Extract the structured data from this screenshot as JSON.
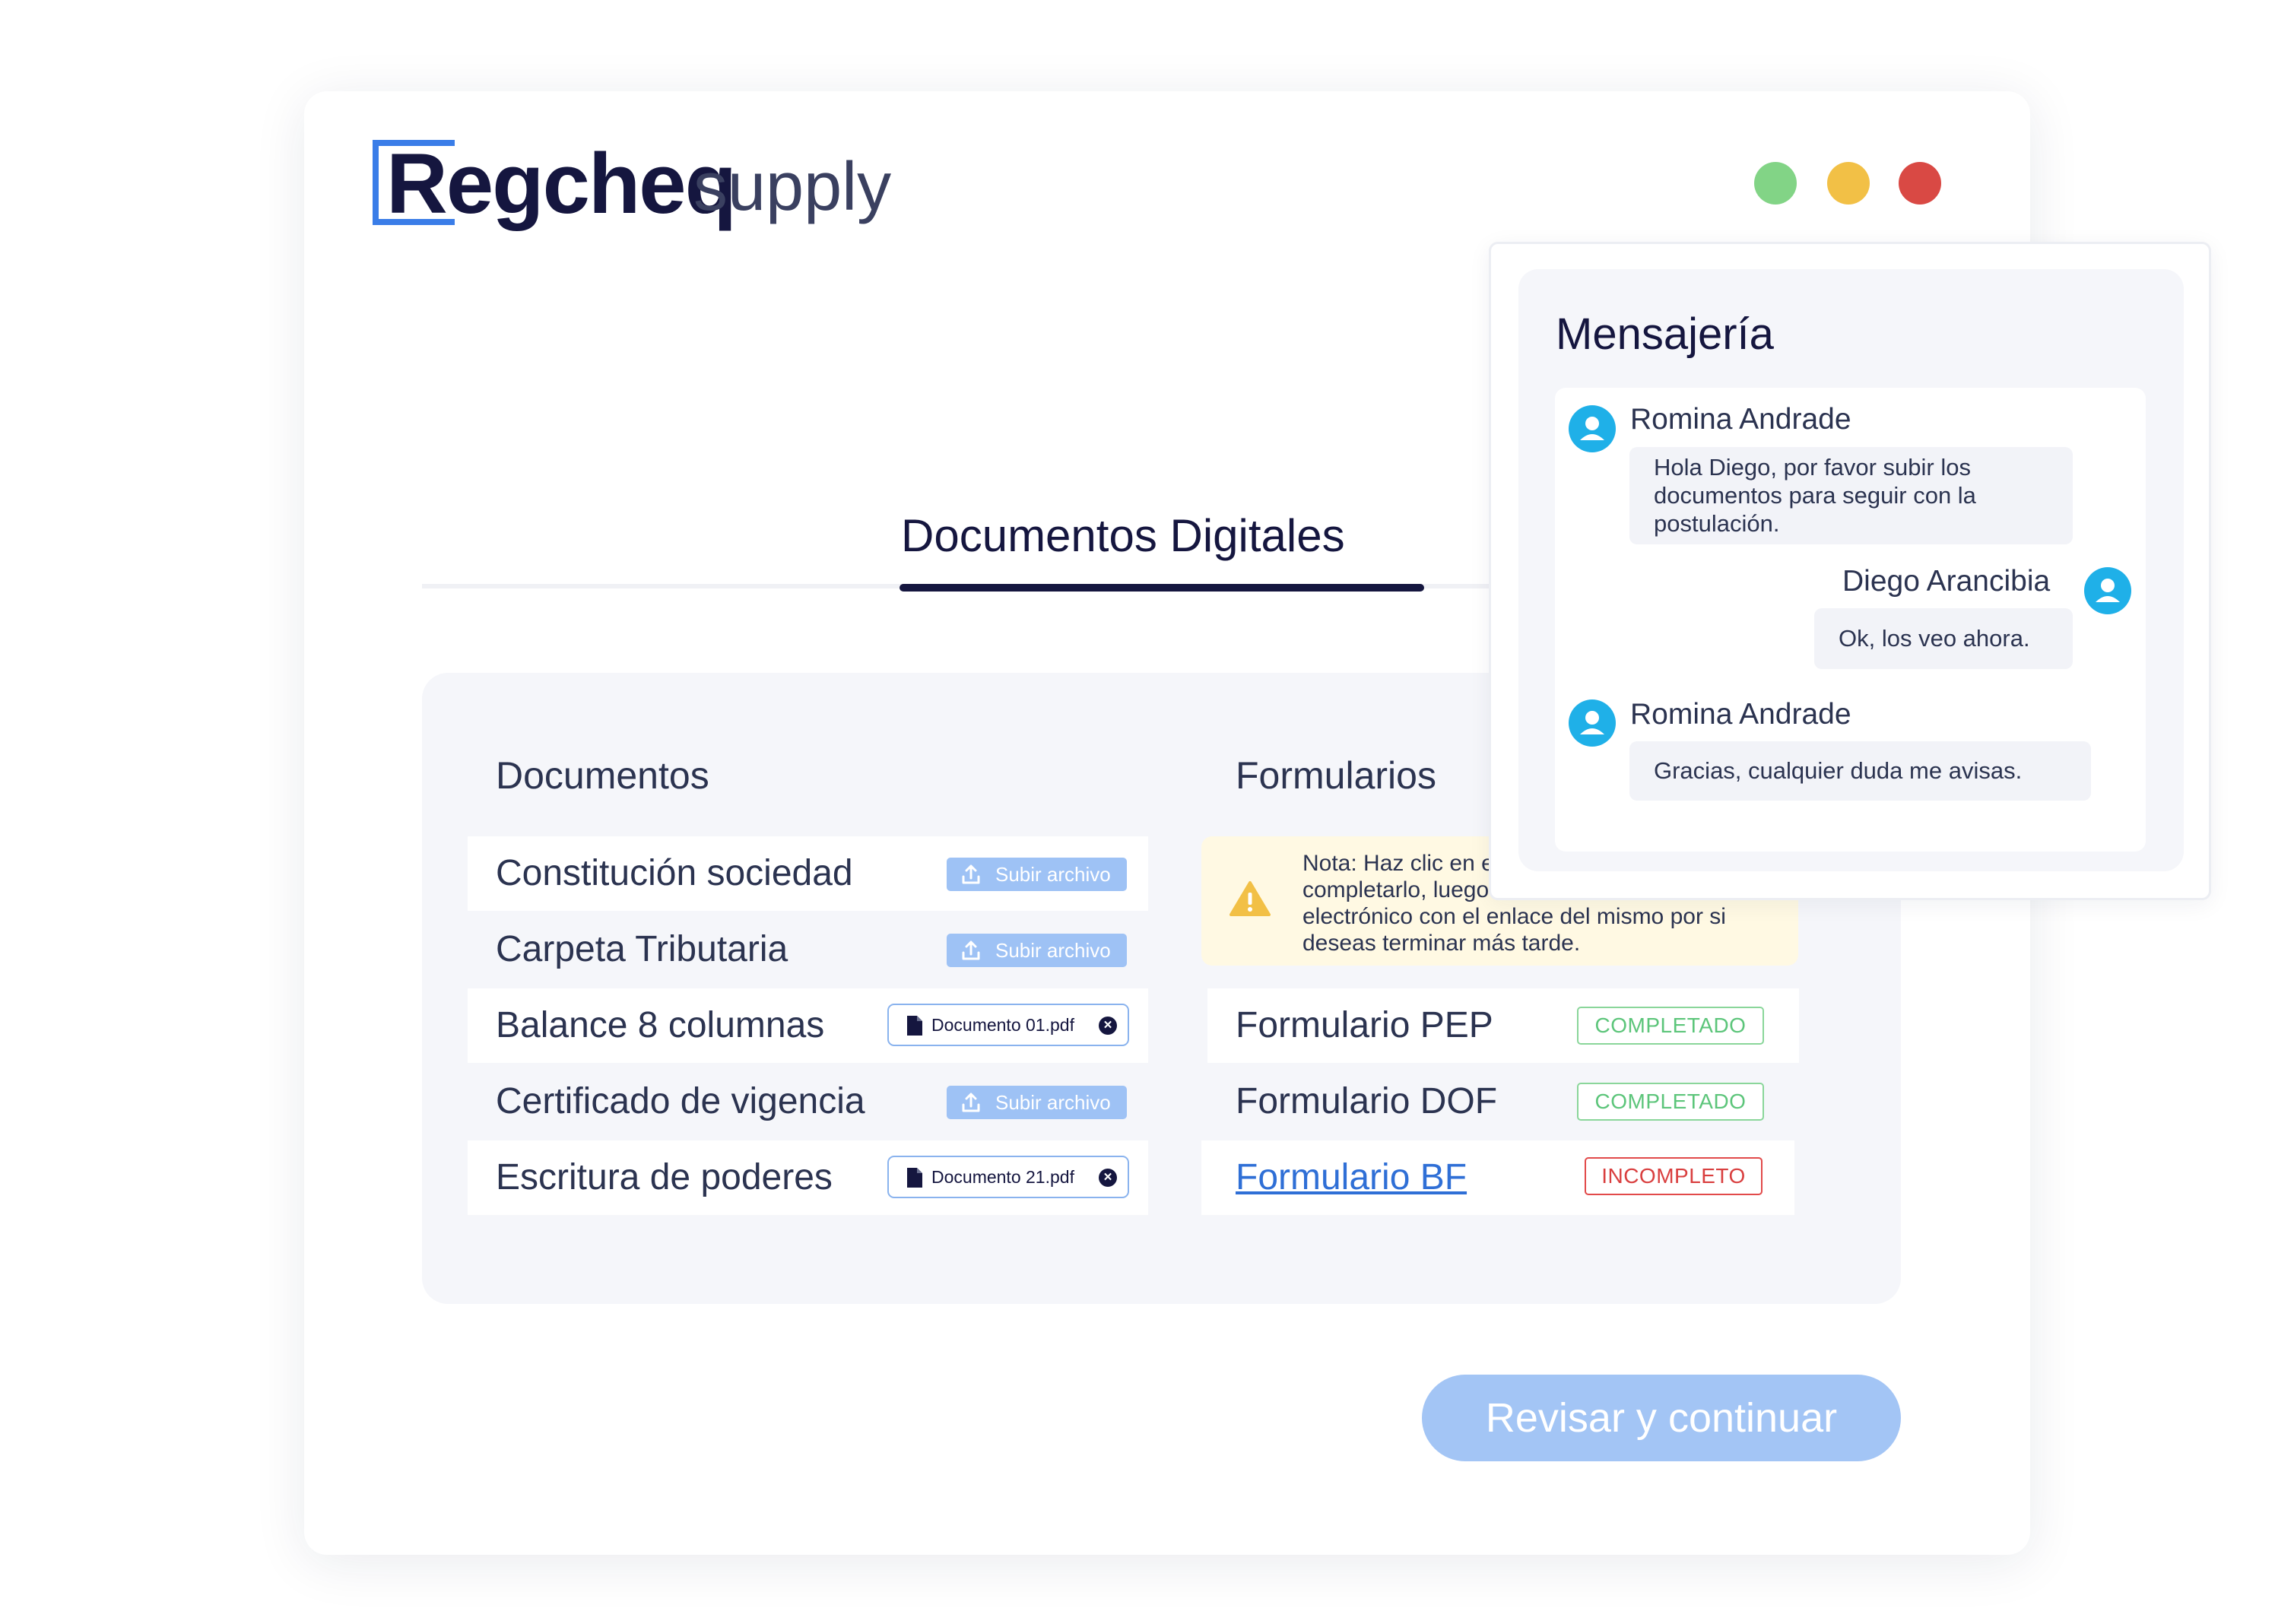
{
  "brand": {
    "name": "Regcheq",
    "product": "supply"
  },
  "window_controls": {
    "colors": {
      "green": "#82d486",
      "yellow": "#f2c046",
      "red": "#d94944"
    }
  },
  "tab": {
    "title": "Documentos Digitales"
  },
  "documents": {
    "heading": "Documentos",
    "rows": [
      {
        "label": "Constitución sociedad",
        "action": "Subir archivo"
      },
      {
        "label": "Carpeta Tributaria",
        "action": "Subir archivo"
      },
      {
        "label": "Balance 8 columnas",
        "file": "Documento 01.pdf"
      },
      {
        "label": "Certificado de vigencia",
        "action": "Subir archivo"
      },
      {
        "label": "Escritura de poderes",
        "file": "Documento 21.pdf"
      }
    ]
  },
  "forms": {
    "heading": "Formularios",
    "note": "Nota: Haz clic en el formulario para completarlo, luego recibirás un correo electrónico con el enlace del mismo por si deseas terminar más tarde.",
    "rows": [
      {
        "label": "Formulario PEP",
        "status": "COMPLETADO"
      },
      {
        "label": "Formulario DOF",
        "status": "COMPLETADO"
      },
      {
        "label": "Formulario BF",
        "status": "INCOMPLETO"
      }
    ]
  },
  "actions": {
    "continue": "Revisar y continuar"
  },
  "messaging": {
    "title": "Mensajería",
    "messages": [
      {
        "sender": "Romina Andrade",
        "text": "Hola Diego, por favor subir los documentos para seguir con la postulación."
      },
      {
        "sender": "Diego Arancibia",
        "text": "Ok, los veo ahora."
      },
      {
        "sender": "Romina Andrade",
        "text": "Gracias, cualquier duda me avisas."
      }
    ]
  },
  "icons": {
    "upload": "upload-icon",
    "file": "file-icon",
    "remove": "close-circle-icon",
    "warning": "warning-icon",
    "avatar": "user-avatar-icon"
  }
}
